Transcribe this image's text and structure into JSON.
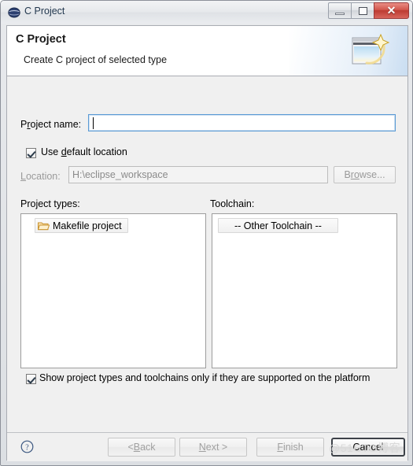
{
  "window": {
    "title": "C Project",
    "icon": "eclipse-globe-icon",
    "controls": {
      "minimize": "minimize-icon",
      "maximize": "restore-icon",
      "close": "✕"
    }
  },
  "header": {
    "title": "C Project",
    "subtitle": "Create C project of selected type",
    "banner_icon": "wizard-window-sparkle-icon"
  },
  "form": {
    "project_name": {
      "label_prefix": "P",
      "label_mnemonic": "r",
      "label_suffix": "oject name:",
      "value": "",
      "placeholder": ""
    },
    "use_default_location": {
      "prefix": "Use ",
      "mnemonic": "d",
      "suffix": "efault location",
      "checked": true
    },
    "location": {
      "label_mnemonic": "L",
      "label_suffix": "ocation:",
      "value": "H:\\eclipse_workspace",
      "enabled": false
    },
    "browse": {
      "prefix": "B",
      "mnemonic": "ro",
      "suffix": "wse...",
      "label": "Browse...",
      "enabled": false
    }
  },
  "lists": {
    "project_types": {
      "label": "Project types:",
      "items": [
        {
          "label": "Makefile project",
          "icon": "folder-icon",
          "selected": true
        }
      ]
    },
    "toolchain": {
      "label": "Toolchain:",
      "items": [
        {
          "label": "-- Other Toolchain --",
          "selected": true
        }
      ]
    }
  },
  "options": {
    "show_supported": {
      "label": "Show project types and toolchains only if they are supported on the platform",
      "checked": true
    }
  },
  "buttons": {
    "help": {
      "icon": "help-circle-icon"
    },
    "back": {
      "prefix": "< ",
      "mnemonic": "B",
      "suffix": "ack",
      "enabled": false
    },
    "next": {
      "prefix": "",
      "mnemonic": "N",
      "suffix": "ext >",
      "enabled": false
    },
    "finish": {
      "prefix": "",
      "mnemonic": "F",
      "suffix": "inish",
      "enabled": false
    },
    "cancel": {
      "label": "Cancel",
      "enabled": true,
      "focused": true
    }
  },
  "watermark": {
    "text": "@51CTO博客"
  },
  "colors": {
    "close_button": "#bc3b32",
    "focus_border": "#5b9bd5",
    "dialog_bg": "#f0f0f0",
    "header_bg": "#ffffff",
    "disabled_text": "#9a9a9a"
  }
}
